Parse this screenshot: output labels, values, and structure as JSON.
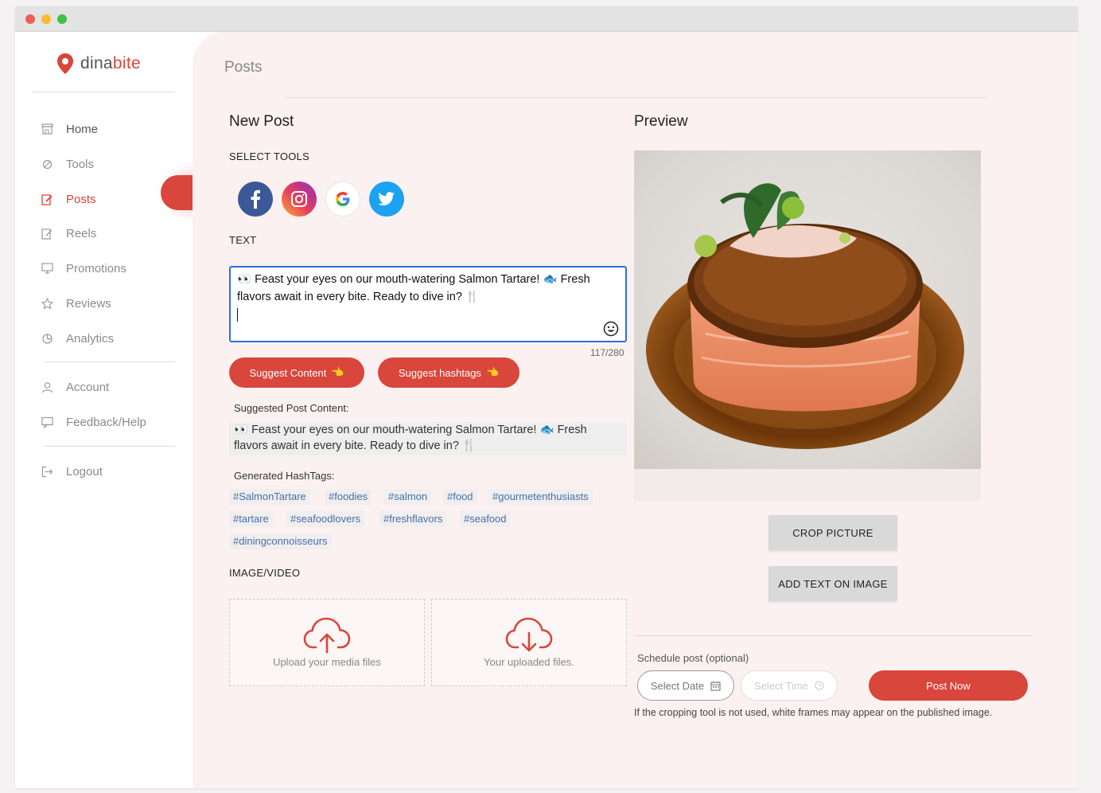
{
  "app": {
    "brand_part1": "dina",
    "brand_part2": "bite"
  },
  "colors": {
    "accent": "#d9463b",
    "facebook": "#3b5998",
    "twitter": "#1da1f2",
    "focus": "#2e6fd6"
  },
  "sidebar": {
    "items": [
      {
        "label": "Home",
        "icon": "store-icon"
      },
      {
        "label": "Tools",
        "icon": "tools-icon"
      },
      {
        "label": "Posts",
        "icon": "edit-icon"
      },
      {
        "label": "Reels",
        "icon": "reels-icon"
      },
      {
        "label": "Promotions",
        "icon": "promotions-icon"
      },
      {
        "label": "Reviews",
        "icon": "star-icon"
      },
      {
        "label": "Analytics",
        "icon": "analytics-icon"
      },
      {
        "label": "Account",
        "icon": "user-icon"
      },
      {
        "label": "Feedback/Help",
        "icon": "feedback-icon"
      },
      {
        "label": "Logout",
        "icon": "logout-icon"
      }
    ]
  },
  "main": {
    "page_title": "Posts",
    "new_post_title": "New Post",
    "select_tools_label": "SELECT TOOLS",
    "text_label": "TEXT",
    "post_text_line1": "👀 Feast your eyes on our mouth-watering Salmon Tartare! 🐟 Fresh",
    "post_text_line2": "flavors await in every bite. Ready to dive in? 🍴",
    "char_counter": "117/280",
    "suggest_content_button": "Suggest Content",
    "suggest_hashtags_button": "Suggest hashtags",
    "suggested_label": "Suggested Post Content:",
    "suggested_line1": "👀 Feast your eyes on our mouth-watering Salmon Tartare! 🐟 Fresh",
    "suggested_line2": "flavors await in every bite. Ready to dive in? 🍴",
    "hashtags_label": "Generated HashTags:",
    "hashtags": [
      "#SalmonTartare",
      "#foodies",
      "#salmon",
      "#food",
      "#gourmetenthusiasts",
      "#tartare",
      "#seafoodlovers",
      "#freshflavors",
      "#seafood",
      "#diningconnoisseurs"
    ],
    "media_label": "IMAGE/VIDEO",
    "upload_text": "Upload your media files",
    "uploaded_text": "Your uploaded files."
  },
  "preview": {
    "title": "Preview",
    "crop_button": "CROP PICTURE",
    "add_text_button": "ADD TEXT ON IMAGE",
    "schedule_label": "Schedule post (optional)",
    "date_placeholder": "Select Date",
    "time_placeholder": "Select Time",
    "post_now_button": "Post Now",
    "note": "If the cropping tool is not used, white frames may appear on the published image."
  }
}
